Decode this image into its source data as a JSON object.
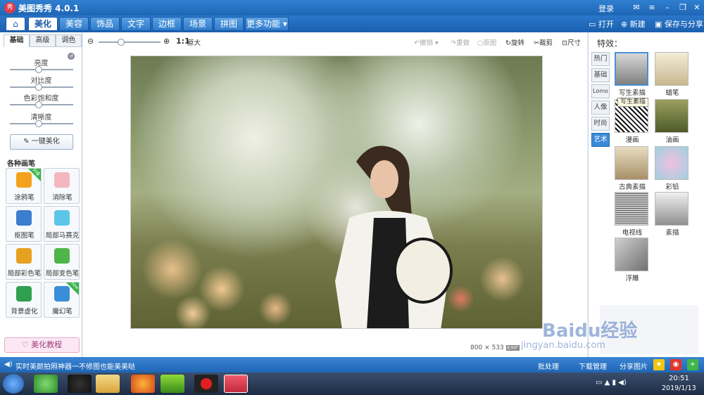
{
  "window": {
    "title": "美图秀秀 4.0.1",
    "login": "登录"
  },
  "nav": {
    "tabs": [
      "美化",
      "美容",
      "饰品",
      "文字",
      "边框",
      "场景",
      "拼图",
      "更多功能"
    ],
    "open": "打开",
    "new": "新建",
    "save": "保存与分享"
  },
  "left": {
    "tabs": [
      "基础",
      "高级",
      "调色"
    ],
    "sliders": [
      {
        "label": "亮度",
        "level": 0.45
      },
      {
        "label": "对比度",
        "level": 0.45
      },
      {
        "label": "色彩饱和度",
        "level": 0.45
      },
      {
        "label": "清晰度",
        "level": 0.45
      }
    ],
    "one_key": "一键美化",
    "section": "各种画笔",
    "brushes": [
      {
        "label": "涂鸦笔",
        "badge": "升级",
        "color": "#f3a21e"
      },
      {
        "label": "消除笔",
        "color": "#f4b7c0"
      },
      {
        "label": "抠图笔",
        "color": "#3a7ed0"
      },
      {
        "label": "局部马赛克",
        "color": "#5cc6e8"
      },
      {
        "label": "局部彩色笔",
        "color": "#e8a020"
      },
      {
        "label": "局部变色笔",
        "color": "#4fb54a"
      },
      {
        "label": "背景虚化",
        "color": "#2fa050"
      },
      {
        "label": "魔幻笔",
        "badge": "new",
        "color": "#3a8ed8"
      }
    ],
    "tutorial": "美化教程"
  },
  "canvas": {
    "zoom_label": "1:1",
    "zoom_text": "原大",
    "zoom_level": 0.35,
    "actions": [
      "撤销",
      "重做",
      "原图",
      "旋转",
      "裁剪",
      "尺寸"
    ],
    "size_w": "800",
    "size_x": "×",
    "size_h": "533",
    "exif": "EXIF"
  },
  "right": {
    "title": "特效：",
    "categories": [
      "热门",
      "基础",
      "Lomo",
      "人像",
      "时尚",
      "艺术"
    ],
    "effects": [
      "写生素描",
      "蜡笔",
      "漫画",
      "油画",
      "古典素描",
      "彩铅",
      "电视线",
      "素描",
      "浮雕"
    ],
    "tooltip": "写生素描"
  },
  "status": {
    "message": "实时美颜拍照神器一不修图也能美美哒",
    "batch": "批处理",
    "download": "下载管理",
    "share": "分享图片"
  },
  "taskbar": {
    "time": "20:51",
    "date": "2019/1/13"
  },
  "watermark": {
    "brand": "Baidu经验",
    "url": "jingyan.baidu.com"
  }
}
